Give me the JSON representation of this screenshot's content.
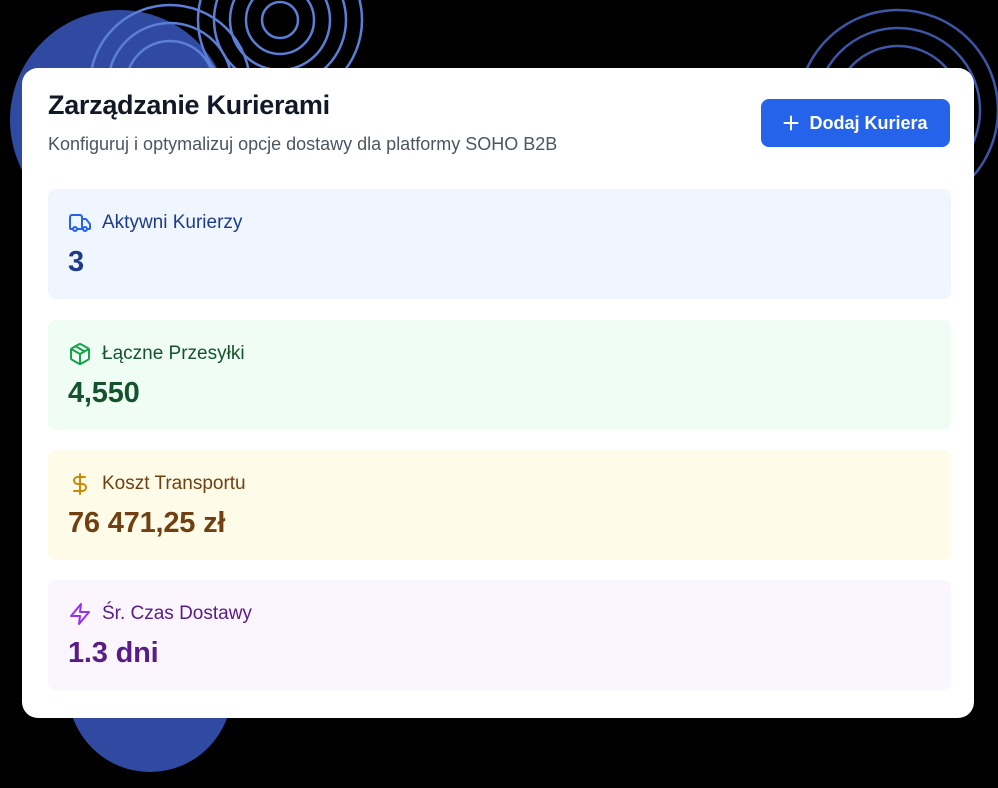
{
  "header": {
    "title": "Zarządzanie Kurierami",
    "subtitle": "Konfiguruj i optymalizuj opcje dostawy dla platformy SOHO B2B",
    "add_button_label": "Dodaj Kuriera",
    "add_button_icon": "plus-icon"
  },
  "stats": [
    {
      "label": "Aktywni Kurierzy",
      "value": "3",
      "icon": "truck-icon",
      "color": "#2563eb",
      "background": "#eff6ff"
    },
    {
      "label": "Łączne Przesyłki",
      "value": "4,550",
      "icon": "package-icon",
      "color": "#16a34a",
      "background": "#f0fdf4"
    },
    {
      "label": "Koszt Transportu",
      "value": "76 471,25 zł",
      "icon": "dollar-icon",
      "color": "#ca8a04",
      "background": "#fefce8"
    },
    {
      "label": "Śr. Czas Dostawy",
      "value": "1.3 dni",
      "icon": "lightning-icon",
      "color": "#9333ea",
      "background": "#faf5ff"
    }
  ],
  "colors": {
    "accent": "#2563eb",
    "page_background": "#000000",
    "decoration": "#5b7fd6"
  }
}
